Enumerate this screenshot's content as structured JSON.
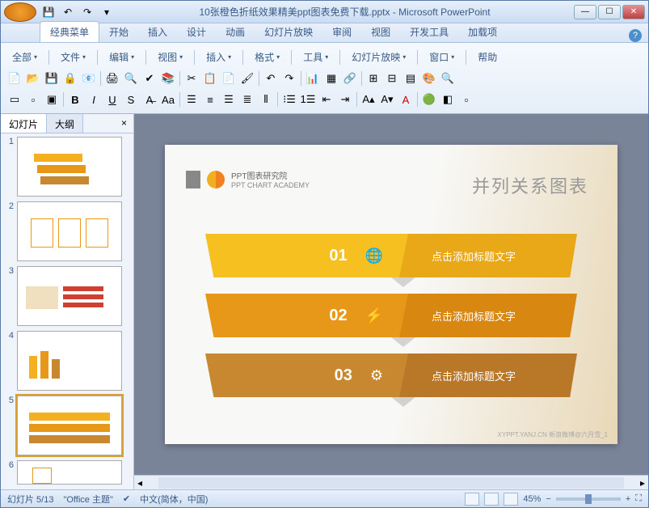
{
  "app": {
    "title": "10张橙色折纸效果精美ppt图表免费下载.pptx - Microsoft PowerPoint"
  },
  "tabs": {
    "t0": "经典菜单",
    "t1": "开始",
    "t2": "插入",
    "t3": "设计",
    "t4": "动画",
    "t5": "幻灯片放映",
    "t6": "审阅",
    "t7": "视图",
    "t8": "开发工具",
    "t9": "加载项"
  },
  "menus": {
    "m0": "全部",
    "m1": "文件",
    "m2": "编辑",
    "m3": "视图",
    "m4": "插入",
    "m5": "格式",
    "m6": "工具",
    "m7": "幻灯片放映",
    "m8": "窗口",
    "m9": "帮助"
  },
  "sidebar": {
    "tab1": "幻灯片",
    "tab2": "大纲",
    "close": "×"
  },
  "thumbs": {
    "n1": "1",
    "n2": "2",
    "n3": "3",
    "n4": "4",
    "n5": "5",
    "n6": "6"
  },
  "slide": {
    "brand_cn": "PPT图表研究院",
    "brand_en": "PPT CHART ACADEMY",
    "title": "并列关系图表",
    "r1_num": "01",
    "r1_txt": "点击添加标题文字",
    "r2_num": "02",
    "r2_txt": "点击添加标题文字",
    "r3_num": "03",
    "r3_txt": "点击添加标题文字",
    "footer": "XYPPT.YANJ.CN 新浪微博@六月雪_1"
  },
  "status": {
    "slide_info": "幻灯片 5/13",
    "theme": "\"Office 主题\"",
    "lang": "中文(简体，中国)",
    "zoom": "45%"
  }
}
